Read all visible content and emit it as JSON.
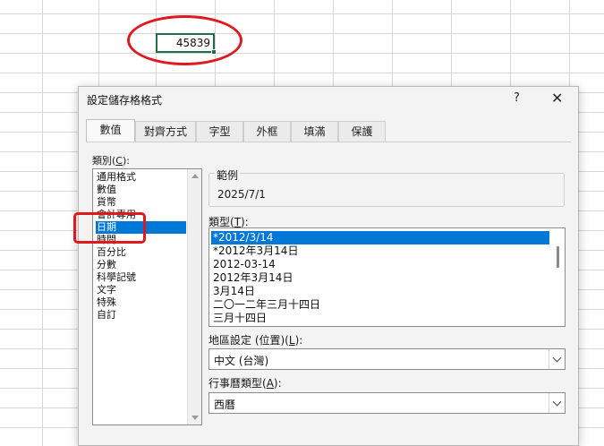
{
  "sheet": {
    "active_cell_value": "45839"
  },
  "dialog": {
    "title": "設定儲存格格式",
    "help": "?",
    "close": "✕",
    "tabs": [
      "數值",
      "對齊方式",
      "字型",
      "外框",
      "填滿",
      "保護"
    ],
    "category_label": "類別(",
    "category_key": "C",
    "category_label_end": "):",
    "categories": [
      "通用格式",
      "數值",
      "貨幣",
      "會計專用",
      "日期",
      "時間",
      "百分比",
      "分數",
      "科學記號",
      "文字",
      "特殊",
      "自訂"
    ],
    "selected_category": "日期",
    "sample_label": "範例",
    "sample_value": "2025/7/1",
    "type_label": "類型(",
    "type_key": "T",
    "type_label_end": "):",
    "types": [
      "*2012/3/14",
      "*2012年3月14日",
      "2012-03-14",
      "2012年3月14日",
      "3月14日",
      "二〇一二年三月十四日",
      "三月十四日"
    ],
    "selected_type": "*2012/3/14",
    "locale_label": "地區設定 (位置)(",
    "locale_key": "L",
    "locale_label_end": "):",
    "locale_value": "中文 (台灣)",
    "calendar_label": "行事曆類型(",
    "calendar_key": "A",
    "calendar_label_end": "):",
    "calendar_value": "西曆"
  }
}
